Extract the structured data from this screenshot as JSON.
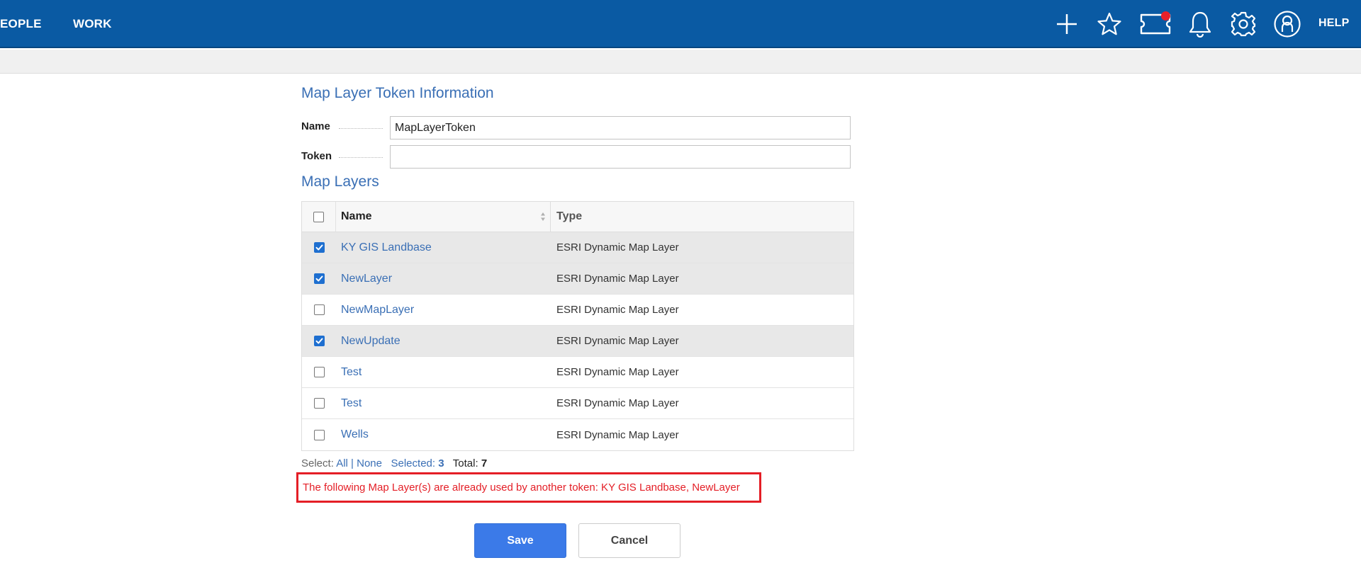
{
  "topnav": {
    "items": [
      {
        "label": "EOPLE"
      },
      {
        "label": "WORK"
      }
    ],
    "help_label": "HELP",
    "icons": [
      "plus-icon",
      "star-icon",
      "ticket-icon",
      "bell-icon",
      "gear-icon",
      "user-icon"
    ]
  },
  "form": {
    "section_title": "Map Layer Token Information",
    "name_label": "Name",
    "name_value": "MapLayerToken",
    "token_label": "Token",
    "token_value": ""
  },
  "layers": {
    "section_title": "Map Layers",
    "columns": {
      "name": "Name",
      "type": "Type"
    },
    "rows": [
      {
        "name": "KY GIS Landbase",
        "type": "ESRI Dynamic Map Layer",
        "checked": true
      },
      {
        "name": "NewLayer",
        "type": "ESRI Dynamic Map Layer",
        "checked": true
      },
      {
        "name": "NewMapLayer",
        "type": "ESRI Dynamic Map Layer",
        "checked": false
      },
      {
        "name": "NewUpdate",
        "type": "ESRI Dynamic Map Layer",
        "checked": true
      },
      {
        "name": "Test",
        "type": "ESRI Dynamic Map Layer",
        "checked": false
      },
      {
        "name": "Test",
        "type": "ESRI Dynamic Map Layer",
        "checked": false
      },
      {
        "name": "Wells",
        "type": "ESRI Dynamic Map Layer",
        "checked": false
      }
    ],
    "select_label": "Select:",
    "all_label": "All",
    "separator": "|",
    "none_label": "None",
    "selected_label": "Selected:",
    "selected_count": "3",
    "total_label": "Total:",
    "total_count": "7"
  },
  "error": {
    "message": "The following Map Layer(s) are already used by another token: KY GIS Landbase, NewLayer"
  },
  "actions": {
    "save_label": "Save",
    "cancel_label": "Cancel"
  },
  "colors": {
    "nav_bg": "#0a5aa3",
    "link": "#3a6fb5",
    "error": "#e41e26",
    "primary_button": "#3b7ae8",
    "notify_dot": "#e8202a"
  }
}
